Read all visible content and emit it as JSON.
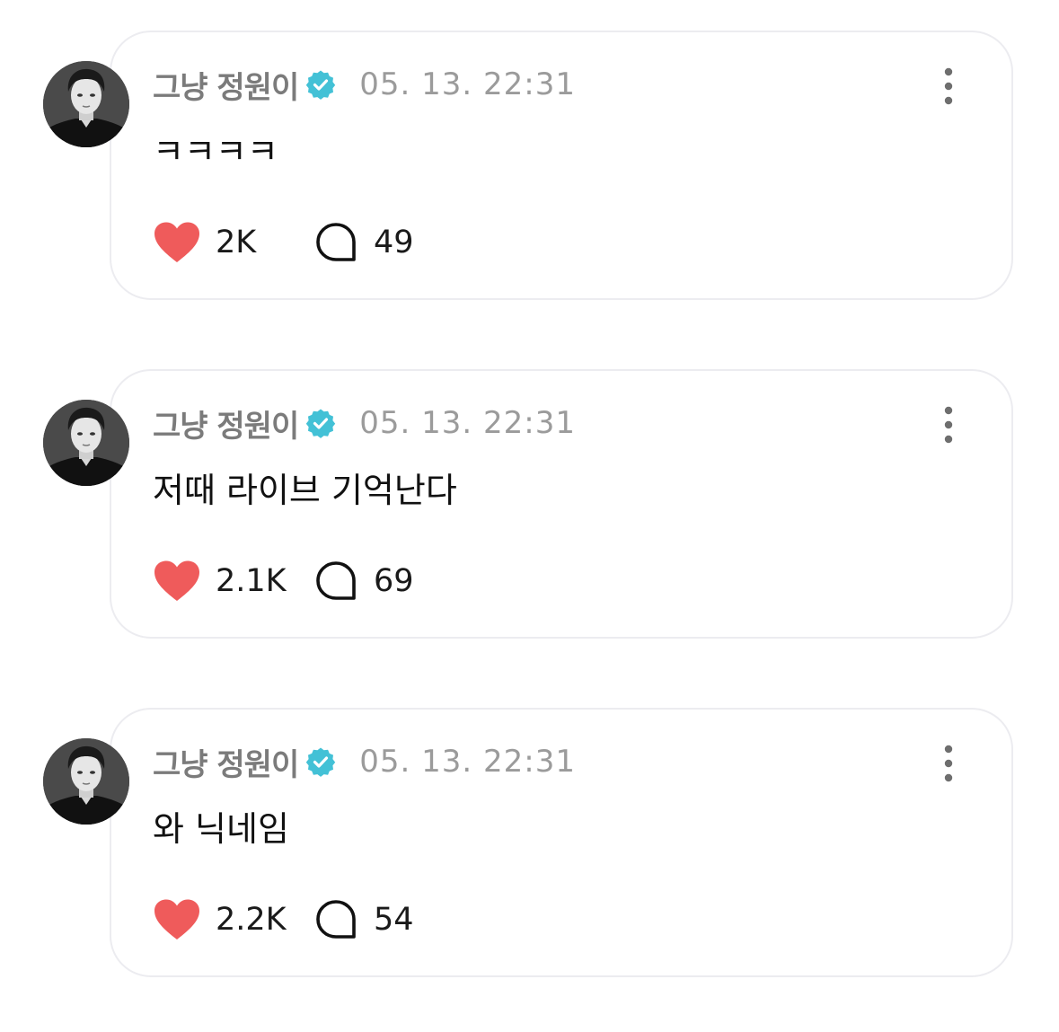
{
  "colors": {
    "heart": "#ef5b5b",
    "verified": "#43c1d6",
    "username": "#7b7b7b",
    "timestamp": "#9b9b9b",
    "card_border": "#ececf0"
  },
  "icons": {
    "like": "heart-icon",
    "comment": "speech-bubble-icon",
    "verified": "verified-badge-icon",
    "more": "more-vertical-icon"
  },
  "comments": [
    {
      "username": "그냥 정원이",
      "timestamp": "05. 13. 22:31",
      "text": "ㅋㅋㅋㅋ",
      "likes": "2K",
      "replies": "49"
    },
    {
      "username": "그냥 정원이",
      "timestamp": "05. 13. 22:31",
      "text": "저때 라이브 기억난다",
      "likes": "2.1K",
      "replies": "69"
    },
    {
      "username": "그냥 정원이",
      "timestamp": "05. 13. 22:31",
      "text": "와 닉네임",
      "likes": "2.2K",
      "replies": "54"
    }
  ]
}
